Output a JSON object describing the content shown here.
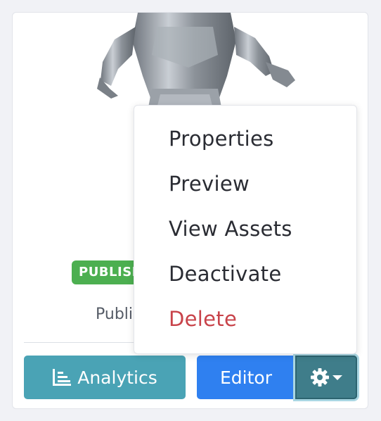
{
  "card": {
    "status_badge": "PUBLISHED",
    "status_text": "Published"
  },
  "actions": {
    "analytics_label": "Analytics",
    "editor_label": "Editor",
    "settings_icon": "gear-icon"
  },
  "menu": {
    "items": [
      {
        "label": "Properties"
      },
      {
        "label": "Preview"
      },
      {
        "label": "View Assets"
      },
      {
        "label": "Deactivate"
      },
      {
        "label": "Delete"
      }
    ]
  },
  "colors": {
    "badge_green": "#4caf50",
    "analytics_teal": "#4aa3b5",
    "editor_blue": "#2f80f0",
    "gear_dark_teal": "#3f7d8a",
    "danger_red": "#c8434a"
  }
}
